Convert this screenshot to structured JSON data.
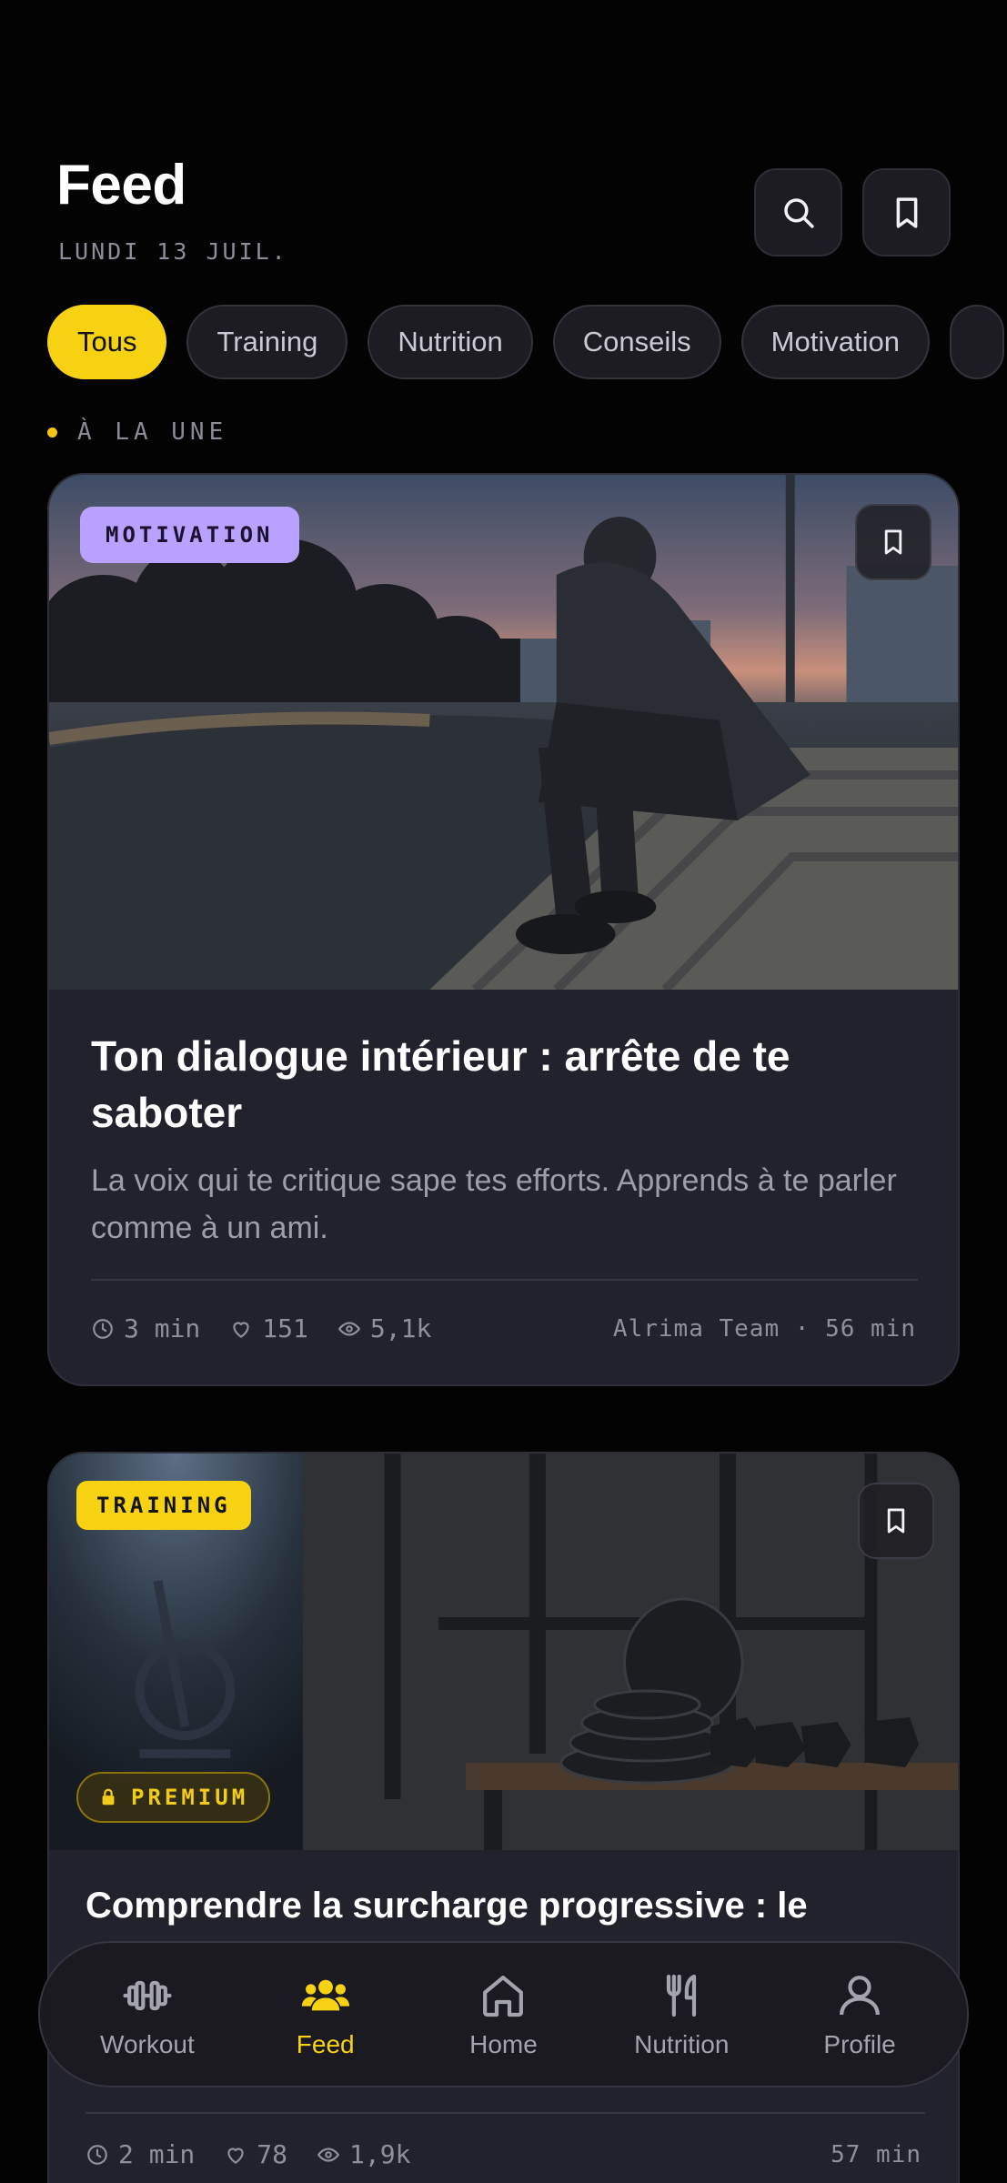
{
  "header": {
    "title": "Feed",
    "date": "LUNDI 13 JUIL.",
    "search_icon": "search-icon",
    "bookmark_icon": "bookmark-icon"
  },
  "filters": {
    "chips": [
      "Tous",
      "Training",
      "Nutrition",
      "Conseils",
      "Motivation"
    ],
    "active": "Tous"
  },
  "section": {
    "label": "À LA UNE"
  },
  "featured": {
    "category": "MOTIVATION",
    "category_color": "#b9a2ff",
    "title": "Ton dialogue intérieur : arrête de te saboter",
    "description": "La voix qui te critique sape tes efforts. Apprends à te parler comme à un ami.",
    "read_time": "3 min",
    "likes": "151",
    "views": "5,1k",
    "byline": "Alrima Team · 56 min"
  },
  "article2": {
    "category": "TRAINING",
    "category_color": "#f7d212",
    "premium_label": "PREMIUM",
    "title": "Comprendre la surcharge progressive : le",
    "read_time": "2 min",
    "likes": "78",
    "views": "1,9k",
    "byline": "57 min"
  },
  "nav": {
    "items": [
      {
        "label": "Workout",
        "icon": "dumbbell-icon"
      },
      {
        "label": "Feed",
        "icon": "people-icon"
      },
      {
        "label": "Home",
        "icon": "home-icon"
      },
      {
        "label": "Nutrition",
        "icon": "fork-knife-icon"
      },
      {
        "label": "Profile",
        "icon": "user-icon"
      }
    ],
    "active": "Feed"
  },
  "colors": {
    "accent": "#f7d212",
    "background": "#030304",
    "card": "#22222c"
  }
}
